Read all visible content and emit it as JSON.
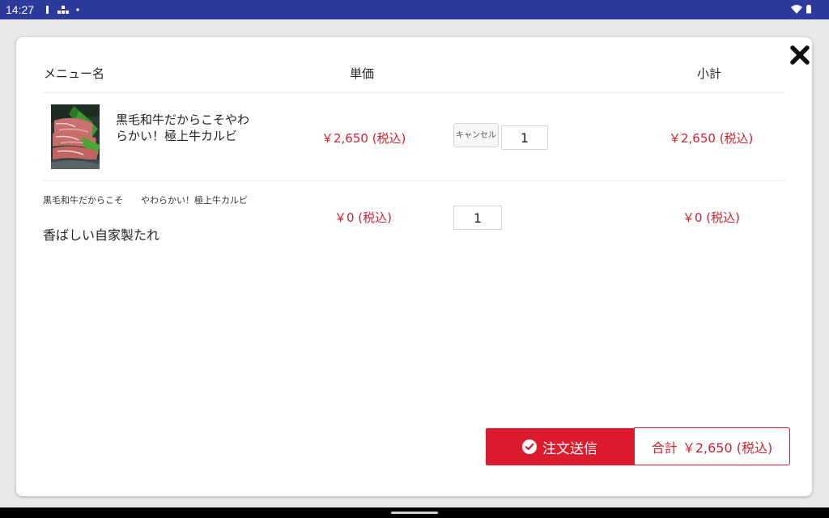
{
  "status_bar": {
    "time": "14:27",
    "left_icons": [
      "sim-card-icon",
      "network-icon",
      "dot-icon"
    ],
    "right_icons": [
      "wifi-icon",
      "battery-icon"
    ],
    "color": "#2d3a9c"
  },
  "table": {
    "headers": {
      "menu_name": "メニュー名",
      "unit_price": "単価",
      "subtotal": "小計"
    }
  },
  "items": [
    {
      "name": "黒毛和牛だからこそやわらかい！極上牛カルビ",
      "unit_price": "￥2,650 (税込)",
      "cancel_label": "キャンセル",
      "quantity": "1",
      "subtotal": "￥2,650 (税込)"
    },
    {
      "parent_name": "黒毛和牛だからこそ　　やわらかい！極上牛カルビ",
      "name": "香ばしい自家製たれ",
      "unit_price": "￥0 (税込)",
      "quantity": "1",
      "subtotal": "￥0 (税込)"
    }
  ],
  "footer": {
    "submit_label": "注文送信",
    "total_label": "合計",
    "total_value": "￥2,650 (税込)"
  },
  "colors": {
    "accent_red": "#dc1c2e",
    "price_red": "#d0232e"
  }
}
